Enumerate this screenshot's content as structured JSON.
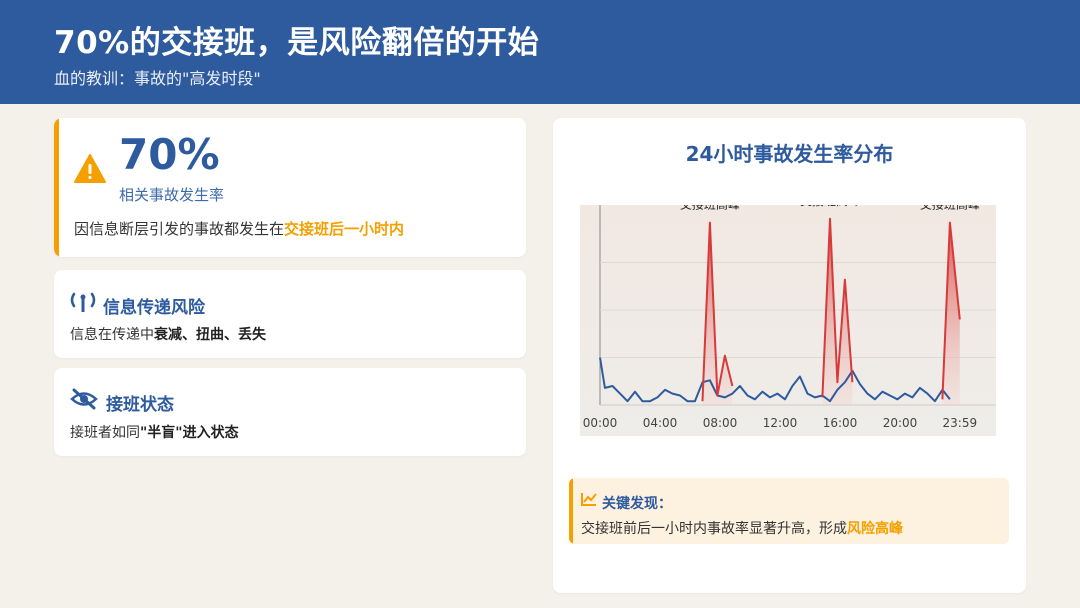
{
  "header": {
    "title": "70%的交接班，是风险翻倍的开始",
    "subtitle": "血的教训：事故的\"高发时段\""
  },
  "stat_card": {
    "value": "70%",
    "label": "相关事故发生率",
    "desc_prefix": "因信息断层引发的事故都发生在",
    "desc_highlight": "交接班后一小时内",
    "icon": "warning-icon"
  },
  "risk_card": {
    "title": "信息传递风险",
    "desc_prefix": "信息在传递中",
    "desc_bold": "衰减、扭曲、丢失",
    "icon": "signal-tower-icon"
  },
  "state_card": {
    "title": "接班状态",
    "desc_prefix": "接班者如同",
    "desc_bold": "\"半盲\"进入状态",
    "icon": "eye-slash-icon"
  },
  "chart_card": {
    "title": "24小时事故发生率分布"
  },
  "chart_data": {
    "type": "line",
    "title": "",
    "xlabel": "",
    "ylabel": "",
    "x_ticks": [
      "00:00",
      "04:00",
      "08:00",
      "12:00",
      "16:00",
      "20:00",
      "23:59"
    ],
    "xlim": [
      0,
      24
    ],
    "ylim": [
      0,
      100
    ],
    "grid": true,
    "legend": "none",
    "series": [
      {
        "color": "#2e5b9e",
        "x": [
          0,
          0.33,
          0.83,
          1.33,
          1.83,
          2.33,
          2.83,
          3.33,
          3.83,
          4.33,
          4.83,
          5.33,
          5.83,
          6.33,
          6.83,
          7.33,
          7.83,
          8.33,
          8.83,
          9.33,
          9.83,
          10.33,
          10.83,
          11.33,
          11.83,
          12.33,
          12.83,
          13.33,
          13.83,
          14.33,
          14.83,
          15.33,
          15.83,
          16.33,
          16.83,
          17.33,
          17.83,
          18.33,
          18.83,
          19.33,
          19.83,
          20.33,
          20.83,
          21.33,
          21.83,
          22.33,
          22.83,
          23.33
        ],
        "y": [
          25,
          9,
          10,
          6,
          2,
          7,
          2,
          2,
          4,
          8,
          6,
          5,
          2,
          2,
          12,
          13,
          5,
          4,
          6,
          10,
          5,
          3,
          7,
          4,
          6,
          3,
          10,
          15,
          6,
          4,
          5,
          2,
          8,
          12,
          18,
          11,
          6,
          3,
          7,
          5,
          3,
          6,
          4,
          9,
          6,
          2,
          8,
          3
        ]
      }
    ],
    "peaks": [
      {
        "label": "交接班高峰",
        "x": [
          6.83,
          7.33,
          7.83,
          8.33,
          8.83
        ],
        "y": [
          2,
          96,
          5,
          26,
          10
        ]
      },
      {
        "label": "交接班高峰",
        "x": [
          14.83,
          15.33,
          15.83,
          16.33,
          16.83
        ],
        "y": [
          4,
          98,
          12,
          66,
          12
        ]
      },
      {
        "label": "交接班高峰",
        "x": [
          22.83,
          23.33,
          23.99
        ],
        "y": [
          3,
          96,
          45
        ]
      }
    ]
  },
  "finding": {
    "title": "关键发现：",
    "desc_prefix": "交接班前后一小时内事故率显著升高，形成",
    "desc_highlight": "风险高峰",
    "icon": "trend-chart-icon"
  },
  "colors": {
    "primary": "#2e5b9e",
    "accent": "#f5a000",
    "peak_red": "#d63a3a"
  }
}
